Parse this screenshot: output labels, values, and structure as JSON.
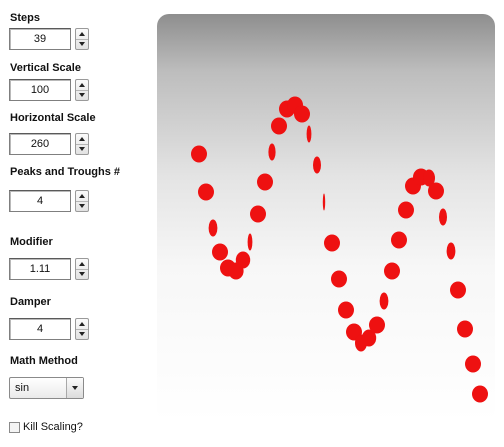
{
  "controls": {
    "steps": {
      "label": "Steps",
      "value": "39"
    },
    "vertical_scale": {
      "label": "Vertical Scale",
      "value": "100"
    },
    "horizontal_scale": {
      "label": "Horizontal Scale",
      "value": "260"
    },
    "peaks_troughs": {
      "label": "Peaks and Troughs #",
      "value": "4"
    },
    "modifier": {
      "label": "Modifier",
      "value": "1.11"
    },
    "damper": {
      "label": "Damper",
      "value": "4"
    },
    "math_method": {
      "label": "Math Method",
      "selected": "sin"
    },
    "kill_scaling": {
      "label": "Kill Scaling?",
      "checked": false
    }
  },
  "animation": {
    "dot_color": "#ee1111",
    "dot_count": 39
  }
}
